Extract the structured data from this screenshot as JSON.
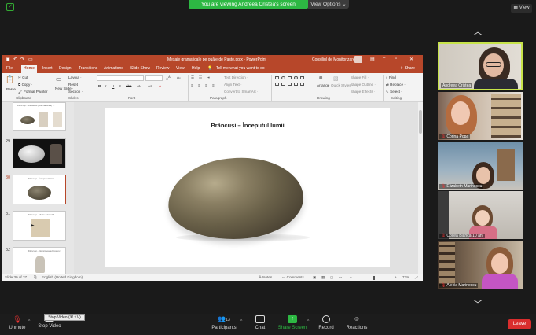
{
  "banner": {
    "viewing_text": "You are viewing Andreea Cristea's screen",
    "view_options": "View Options ⌄",
    "view_button": "View"
  },
  "ppt": {
    "title": "Mesaje gramaticale pe ouăle de Paște.pptx  -  PowerPoint",
    "user": "Consiliul de Monitorizare",
    "tabs": [
      "File",
      "Home",
      "Insert",
      "Design",
      "Transitions",
      "Animations",
      "Slide Show",
      "Review",
      "View",
      "Help"
    ],
    "tell_me": "Tell me what you want to do",
    "share": "Share",
    "ribbon": {
      "paste": "Paste",
      "cut": "Cut",
      "copy": "Copy ·",
      "format_painter": "Format Painter",
      "new_slide": "New Slide ·",
      "layout": "Layout ·",
      "reset": "Reset",
      "section": "Section ·",
      "text_direction": "Text Direction ·",
      "align_text": "Align Text ·",
      "convert_smartart": "Convert to SmartArt ·",
      "arrange": "Arrange",
      "quick_styles": "Quick Styles ·",
      "shape_fill": "Shape Fill ·",
      "shape_outline": "Shape Outline ·",
      "shape_effects": "Shape Effects ·",
      "find": "Find",
      "replace": "Replace ·",
      "select": "Select ·",
      "groups": [
        "Clipboard",
        "Slides",
        "Font",
        "Paragraph",
        "Drawing",
        "Editing"
      ]
    },
    "thumbnails": [
      {
        "num": "28",
        "caption": "Brâncuși - Măiastra (altă variantă) ..."
      },
      {
        "num": "29",
        "caption": ""
      },
      {
        "num": "30",
        "caption": "Brâncuși - Începutul lumii"
      },
      {
        "num": "31",
        "caption": "Brâncuși - Muza adormită"
      },
      {
        "num": "32",
        "caption": "Brâncuși - Domnișoara Pogany"
      }
    ],
    "slide_title": "Brâncuși – Începutul lumii",
    "status": {
      "slide_of": "Slide 30 of 37",
      "language": "English (United Kingdom)",
      "notes": "Notes",
      "comments": "Comments",
      "zoom": "72%"
    }
  },
  "gallery": [
    {
      "name": "Andreea Cristea",
      "muted": false
    },
    {
      "name": "Corina Popa",
      "muted": true
    },
    {
      "name": "Elizabeth Marinescu",
      "muted": true
    },
    {
      "name": "Coltea Blanca-10 ani",
      "muted": true
    },
    {
      "name": "Alexia Marinescu",
      "muted": true
    }
  ],
  "toolbar": {
    "unmute": "Unmute",
    "stop_video": "Stop Video",
    "tooltip": "Stop Video (⌘⇧V)",
    "participants": "Participants",
    "participants_count": "13",
    "chat": "Chat",
    "share_screen": "Share Screen",
    "record": "Record",
    "reactions": "Reactions",
    "leave": "Leave"
  },
  "colors": {
    "ppt_accent": "#b7472a",
    "share_green": "#2db843",
    "leave_red": "#d92d2d",
    "active_speaker": "#c7e34a"
  }
}
